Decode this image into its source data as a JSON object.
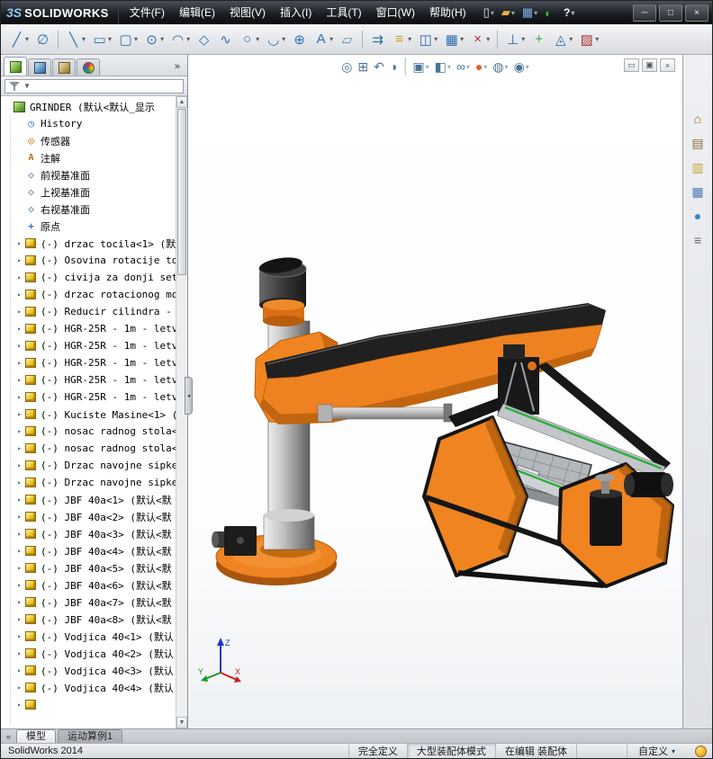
{
  "colors": {
    "machine_orange": "#ef8420",
    "machine_black": "#1a1a1a",
    "rail_green": "#2fae3f",
    "accent_blue": "#51708c"
  },
  "titlebar": {
    "logo_mark": "3S",
    "logo_text": "SOLIDWORKS",
    "menus": [
      "文件(F)",
      "编辑(E)",
      "视图(V)",
      "插入(I)",
      "工具(T)",
      "窗口(W)",
      "帮助(H)"
    ],
    "quick_icons": [
      {
        "name": "new-document",
        "glyph": "▯",
        "color": "#e8e8e8",
        "dd": true
      },
      {
        "name": "open-document",
        "glyph": "▰",
        "color": "#e8b33a",
        "dd": true
      },
      {
        "name": "save-document",
        "glyph": "▦",
        "color": "#7ab0e8",
        "dd": true
      },
      {
        "name": "performance-indicator",
        "glyph": "◐",
        "color": "#40b040"
      }
    ],
    "help_label": "?",
    "window_controls": [
      {
        "name": "minimize-window",
        "glyph": "─"
      },
      {
        "name": "maximize-window",
        "glyph": "□"
      },
      {
        "name": "close-window",
        "glyph": "×"
      }
    ]
  },
  "toolbar": {
    "icons": [
      {
        "name": "sketch",
        "glyph": "╱",
        "color": "#2f6fae",
        "dd": true
      },
      {
        "name": "smart-dimension",
        "glyph": "∅",
        "color": "#2f6fae"
      },
      {
        "sep": true
      },
      {
        "name": "line",
        "glyph": "╲",
        "color": "#2f6fae",
        "dd": true
      },
      {
        "name": "corner-rectangle",
        "glyph": "▭",
        "color": "#2f6fae",
        "dd": true
      },
      {
        "name": "straight-slot",
        "glyph": "▢",
        "color": "#2f6fae",
        "dd": true
      },
      {
        "name": "circle",
        "glyph": "⊙",
        "color": "#2f6fae",
        "dd": true
      },
      {
        "name": "centerpoint-arc",
        "glyph": "◠",
        "color": "#2f6fae",
        "dd": true
      },
      {
        "name": "polygon",
        "glyph": "◇",
        "color": "#2f6fae"
      },
      {
        "name": "spline",
        "glyph": "∿",
        "color": "#2f6fae"
      },
      {
        "name": "ellipse",
        "glyph": "○",
        "color": "#2f6fae",
        "dd": true
      },
      {
        "name": "sketch-fillet",
        "glyph": "◡",
        "color": "#2f6fae",
        "dd": true
      },
      {
        "name": "point",
        "glyph": "⊕",
        "color": "#2f6fae"
      },
      {
        "name": "text",
        "glyph": "A",
        "color": "#2f6fae",
        "dd": true
      },
      {
        "name": "plane",
        "glyph": "▱",
        "color": "#5a8ab5"
      },
      {
        "sep": true
      },
      {
        "name": "convert-entities",
        "glyph": "⇉",
        "color": "#2f6fae"
      },
      {
        "name": "offset-entities",
        "glyph": "≡",
        "color": "#c8a018",
        "dd": true
      },
      {
        "name": "mirror-entities",
        "glyph": "◫",
        "color": "#2f6fae",
        "dd": true
      },
      {
        "name": "linear-sketch-pattern",
        "glyph": "▦",
        "color": "#2f6fae",
        "dd": true
      },
      {
        "name": "trim-entities",
        "glyph": "×",
        "color": "#b03030",
        "dd": true
      },
      {
        "sep": true
      },
      {
        "name": "display-relations",
        "glyph": "⊥",
        "color": "#2f6fae",
        "dd": true
      },
      {
        "name": "repair-sketch",
        "glyph": "+",
        "color": "#30a030"
      },
      {
        "name": "quick-snaps",
        "glyph": "◬",
        "color": "#2f6fae",
        "dd": true
      },
      {
        "name": "rapid-sketch",
        "glyph": "▨",
        "color": "#b03030",
        "dd": true
      }
    ]
  },
  "left_panel": {
    "tabs": [
      {
        "name": "featuremanager-tab",
        "icon": "featuremanager-icon"
      },
      {
        "name": "propertymanager-tab",
        "icon": "propertymanager-icon"
      },
      {
        "name": "configurationmanager-tab",
        "icon": "configurationmanager-icon"
      },
      {
        "name": "dimxpert-tab",
        "icon": "dimxpert-icon"
      }
    ],
    "overflow": "»",
    "filter_dd": "▼",
    "scrollbar": {
      "up": "▲",
      "down": "▼"
    }
  },
  "feature_tree": {
    "items": [
      {
        "label": "GRINDER (默认<默认_显示",
        "icon": "assembly",
        "root": true
      },
      {
        "label": "History",
        "icon": "history"
      },
      {
        "label": "传感器",
        "icon": "sensors"
      },
      {
        "label": "注解",
        "icon": "annotations"
      },
      {
        "label": "前视基准面",
        "icon": "plane"
      },
      {
        "label": "上视基准面",
        "icon": "plane"
      },
      {
        "label": "右视基准面",
        "icon": "plane"
      },
      {
        "label": "原点",
        "icon": "origin"
      },
      {
        "label": "(-) drzac tocila<1> (默",
        "icon": "component",
        "arrow": true
      },
      {
        "label": "(-) Osovina rotacije to",
        "icon": "component",
        "arrow": true
      },
      {
        "label": "(-) civija za donji set",
        "icon": "component",
        "arrow": true
      },
      {
        "label": "(-) drzac rotacionog mo",
        "icon": "component",
        "arrow": true
      },
      {
        "label": "(-) Reducir cilindra -",
        "icon": "component",
        "arrow": true
      },
      {
        "label": "(-) HGR-25R - 1m - letv",
        "icon": "component",
        "arrow": true
      },
      {
        "label": "(-) HGR-25R - 1m - letv",
        "icon": "component",
        "arrow": true
      },
      {
        "label": "(-) HGR-25R - 1m - letv",
        "icon": "component",
        "arrow": true
      },
      {
        "label": "(-) HGR-25R - 1m - letv",
        "icon": "component",
        "arrow": true
      },
      {
        "label": "(-) HGR-25R - 1m - letv",
        "icon": "component",
        "arrow": true
      },
      {
        "label": "(-) Kuciste Masine<1> (默",
        "icon": "component",
        "arrow": true
      },
      {
        "label": "(-) nosac radnog stola<",
        "icon": "component",
        "arrow": true
      },
      {
        "label": "(-) nosac radnog stola<",
        "icon": "component",
        "arrow": true
      },
      {
        "label": "(-) Drzac navojne sipke",
        "icon": "component",
        "arrow": true
      },
      {
        "label": "(-) Drzac navojne sipke",
        "icon": "component",
        "arrow": true
      },
      {
        "label": "(-) JBF 40a<1> (默认<默",
        "icon": "component",
        "arrow": true
      },
      {
        "label": "(-) JBF 40a<2> (默认<默",
        "icon": "component",
        "arrow": true
      },
      {
        "label": "(-) JBF 40a<3> (默认<默",
        "icon": "component",
        "arrow": true
      },
      {
        "label": "(-) JBF 40a<4> (默认<默",
        "icon": "component",
        "arrow": true
      },
      {
        "label": "(-) JBF 40a<5> (默认<默",
        "icon": "component",
        "arrow": true
      },
      {
        "label": "(-) JBF 40a<6> (默认<默",
        "icon": "component",
        "arrow": true
      },
      {
        "label": "(-) JBF 40a<7> (默认<默",
        "icon": "component",
        "arrow": true
      },
      {
        "label": "(-) JBF 40a<8> (默认<默",
        "icon": "component",
        "arrow": true
      },
      {
        "label": "(-) Vodjica 40<1> (默认",
        "icon": "component",
        "arrow": true
      },
      {
        "label": "(-) Vodjica 40<2> (默认",
        "icon": "component",
        "arrow": true
      },
      {
        "label": "(-) Vodjica 40<3> (默认",
        "icon": "component",
        "arrow": true
      },
      {
        "label": "(-) Vodjica 40<4> (默认",
        "icon": "component",
        "arrow": true
      },
      {
        "label": "",
        "icon": "component",
        "arrow": true
      }
    ]
  },
  "viewport": {
    "headsup": [
      {
        "name": "zoom-to-fit",
        "glyph": "◎"
      },
      {
        "name": "zoom-to-area",
        "glyph": "⊞"
      },
      {
        "name": "previous-view",
        "glyph": "↶"
      },
      {
        "name": "section-view",
        "glyph": "◑"
      },
      {
        "sep": true
      },
      {
        "name": "view-orientation",
        "glyph": "▣",
        "dd": true
      },
      {
        "name": "display-style",
        "glyph": "◧",
        "dd": true
      },
      {
        "name": "hide-show-items",
        "glyph": "∞",
        "dd": true
      },
      {
        "name": "edit-appearance",
        "glyph": "●",
        "color": "#d86a2a",
        "dd": true
      },
      {
        "name": "apply-scene",
        "glyph": "◍",
        "dd": true
      },
      {
        "name": "view-settings",
        "glyph": "◉",
        "dd": true
      }
    ],
    "doc_controls": [
      {
        "name": "minimize-document",
        "glyph": "▭"
      },
      {
        "name": "restore-document",
        "glyph": "▣"
      },
      {
        "name": "close-document",
        "glyph": "×"
      }
    ],
    "triad": {
      "x": "X",
      "y": "Y",
      "z": "Z"
    }
  },
  "task_pane": {
    "icons": [
      {
        "name": "solidworks-resources",
        "glyph": "⌂",
        "color": "#c2571a"
      },
      {
        "name": "design-library",
        "glyph": "▤",
        "color": "#8a6d3b"
      },
      {
        "name": "file-explorer",
        "glyph": "▥",
        "color": "#caa53d"
      },
      {
        "name": "view-palette",
        "glyph": "▦",
        "color": "#4a7ab5"
      },
      {
        "name": "appearances-scenes",
        "glyph": "●",
        "color": "#3a86c8"
      },
      {
        "name": "custom-properties",
        "glyph": "≡",
        "color": "#666666"
      }
    ]
  },
  "bottom_tabs": {
    "scroll_left": "«",
    "tabs": [
      {
        "label": "模型",
        "active": true
      },
      {
        "label": "运动算例1",
        "active": false
      }
    ]
  },
  "statusbar": {
    "app_version": "SolidWorks 2014",
    "fields": [
      "完全定义",
      "大型装配体模式",
      "在编辑 装配体"
    ],
    "custom_label": "自定义"
  }
}
